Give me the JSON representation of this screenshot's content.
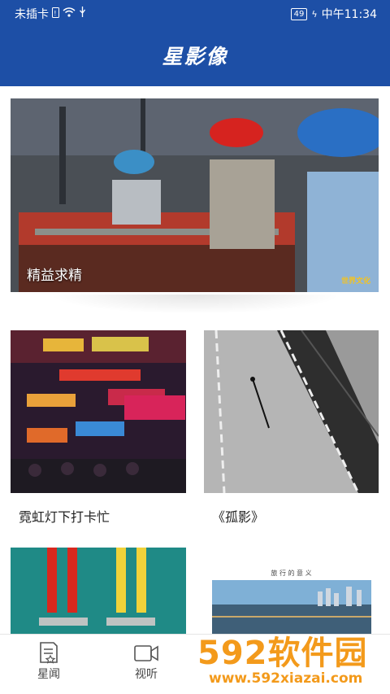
{
  "status_bar": {
    "carrier": "未插卡",
    "battery": "49",
    "time": "中午11:34"
  },
  "header": {
    "title": "星影像"
  },
  "feature": {
    "caption": "精益求精",
    "badge": "世界文化"
  },
  "cards": [
    {
      "title": "霓虹灯下打卡忙"
    },
    {
      "title": "《孤影》"
    },
    {
      "title": ""
    },
    {
      "title": "旅 行 的 意 义"
    }
  ],
  "tabs": [
    {
      "label": "星闻",
      "icon": "news-icon"
    },
    {
      "label": "视听",
      "icon": "camera-icon"
    }
  ],
  "watermark": {
    "brand": "592软件园",
    "url": "www.592xiazai.com"
  },
  "colors": {
    "header": "#1d4fa6",
    "watermark_orange": "#f39a1b"
  }
}
